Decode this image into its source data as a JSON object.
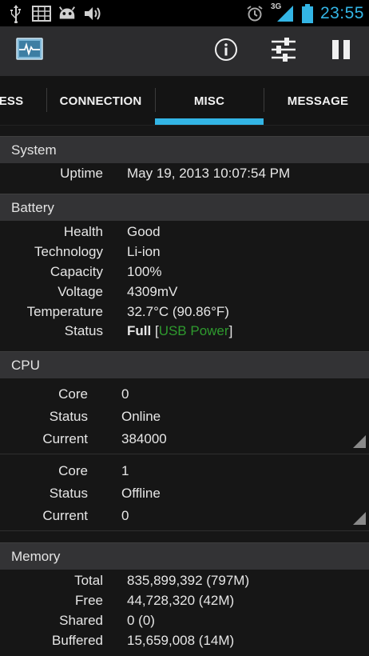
{
  "status_bar": {
    "time": "23:55",
    "network_type": "3G",
    "icons_left": [
      "usb-icon",
      "keyboard-icon",
      "android-icon",
      "volume-icon"
    ],
    "icons_right": [
      "alarm-icon",
      "signal-icon",
      "battery-icon"
    ]
  },
  "action_bar": {
    "icons": [
      "app-logo-icon",
      "info-icon",
      "settings-sliders-icon",
      "pause-icon"
    ]
  },
  "tabs": [
    {
      "label": "ESS"
    },
    {
      "label": "CONNECTION"
    },
    {
      "label": "MISC",
      "selected": true
    },
    {
      "label": "MESSAGE"
    }
  ],
  "accent_color": "#33b5e5",
  "system": {
    "title": "System",
    "rows": [
      {
        "label": "Uptime",
        "value": "May 19, 2013 10:07:54 PM"
      }
    ]
  },
  "battery": {
    "title": "Battery",
    "rows": [
      {
        "label": "Health",
        "value": "Good"
      },
      {
        "label": "Technology",
        "value": "Li-ion"
      },
      {
        "label": "Capacity",
        "value": "100%"
      },
      {
        "label": "Voltage",
        "value": "4309mV"
      },
      {
        "label": "Temperature",
        "value": "32.7°C (90.86°F)"
      }
    ],
    "status": {
      "label": "Status",
      "value": "Full",
      "open": "[",
      "source": "USB Power",
      "close": "]"
    }
  },
  "cpu": {
    "title": "CPU",
    "cores": [
      {
        "core_label": "Core",
        "core_value": "0",
        "status_label": "Status",
        "status_value": "Online",
        "current_label": "Current",
        "current_value": "384000"
      },
      {
        "core_label": "Core",
        "core_value": "1",
        "status_label": "Status",
        "status_value": "Offline",
        "current_label": "Current",
        "current_value": "0"
      }
    ]
  },
  "memory": {
    "title": "Memory",
    "rows": [
      {
        "label": "Total",
        "value": "835,899,392 (797M)"
      },
      {
        "label": "Free",
        "value": "44,728,320 (42M)"
      },
      {
        "label": "Shared",
        "value": "0 (0)"
      },
      {
        "label": "Buffered",
        "value": "15,659,008 (14M)"
      }
    ]
  }
}
